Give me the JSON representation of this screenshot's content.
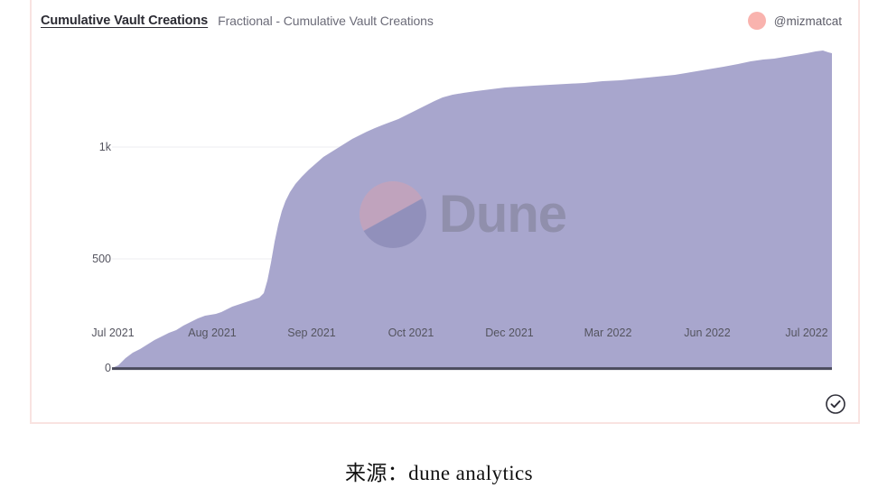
{
  "card": {
    "title": "Cumulative Vault Creations",
    "subtitle": "Fractional - Cumulative Vault Creations",
    "author_handle": "@mizmatcat",
    "avatar_icon": "avatar-circle-icon",
    "verified_icon": "check-circle-icon",
    "border_color": "#f9e3e1",
    "avatar_color": "#f9b3ae"
  },
  "watermark": {
    "text": "Dune",
    "logo_icon": "dune-logo-icon",
    "logo_colors": [
      "#e8a0a4",
      "#6d6f9e"
    ]
  },
  "caption": {
    "text": "来源：dune analytics"
  },
  "chart_data": {
    "type": "area",
    "title": "Cumulative Vault Creations",
    "subtitle": "Fractional - Cumulative Vault Creations",
    "xlabel": "",
    "ylabel": "",
    "grid": true,
    "legend": "none",
    "series_color": "#a8a6cd",
    "axis_color": "#4a4a5c",
    "ylim": [
      0,
      1430
    ],
    "y_ticks": [
      {
        "value": 0,
        "label": "0"
      },
      {
        "value": 500,
        "label": "500"
      },
      {
        "value": 1000,
        "label": "1k"
      }
    ],
    "x_ticks": [
      {
        "label": "Jul 2021",
        "pos": 0.0
      },
      {
        "label": "Aug 2021",
        "pos": 0.139
      },
      {
        "label": "Sep 2021",
        "pos": 0.277
      },
      {
        "label": "Oct 2021",
        "pos": 0.414
      },
      {
        "label": "Dec 2021",
        "pos": 0.552
      },
      {
        "label": "Mar 2022",
        "pos": 0.691
      },
      {
        "label": "Jun 2022",
        "pos": 0.829
      },
      {
        "label": "Jul 2022",
        "pos": 0.967
      }
    ],
    "x": [
      "Jul 2021",
      "Aug 2021",
      "Sep 2021",
      "Oct 2021",
      "Dec 2021",
      "Mar 2022",
      "Jun 2022",
      "Jul 2022"
    ],
    "series": [
      {
        "name": "Cumulative Vault Creations",
        "points": [
          {
            "x": "2021-07-01",
            "y": 0
          },
          {
            "x": "2021-07-08",
            "y": 30
          },
          {
            "x": "2021-07-16",
            "y": 110
          },
          {
            "x": "2021-07-24",
            "y": 175
          },
          {
            "x": "2021-08-01",
            "y": 245
          },
          {
            "x": "2021-08-10",
            "y": 300
          },
          {
            "x": "2021-08-18",
            "y": 330
          },
          {
            "x": "2021-08-24",
            "y": 360
          },
          {
            "x": "2021-08-28",
            "y": 520
          },
          {
            "x": "2021-09-01",
            "y": 700
          },
          {
            "x": "2021-09-08",
            "y": 830
          },
          {
            "x": "2021-09-15",
            "y": 930
          },
          {
            "x": "2021-09-22",
            "y": 1000
          },
          {
            "x": "2021-10-01",
            "y": 1055
          },
          {
            "x": "2021-10-15",
            "y": 1110
          },
          {
            "x": "2021-11-01",
            "y": 1175
          },
          {
            "x": "2021-12-01",
            "y": 1200
          },
          {
            "x": "2022-01-01",
            "y": 1215
          },
          {
            "x": "2022-03-01",
            "y": 1250
          },
          {
            "x": "2022-05-01",
            "y": 1285
          },
          {
            "x": "2022-06-01",
            "y": 1310
          },
          {
            "x": "2022-06-20",
            "y": 1355
          },
          {
            "x": "2022-07-01",
            "y": 1400
          },
          {
            "x": "2022-07-20",
            "y": 1430
          }
        ]
      }
    ]
  }
}
